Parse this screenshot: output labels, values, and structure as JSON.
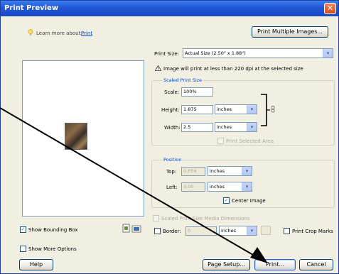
{
  "window": {
    "title": "Print Preview",
    "close_glyph": "✕"
  },
  "learn": {
    "prefix": "Learn more about:",
    "link": "Print"
  },
  "print_multiple_label": "Print Multiple Images...",
  "print_size": {
    "label": "Print Size:",
    "value": "Actual Size (2.50\" x 1.88\")"
  },
  "warning": "Image will print at less than 220 dpi at the selected size",
  "scaled": {
    "title": "Scaled Print Size",
    "scale_label": "Scale:",
    "scale_value": "100%",
    "height_label": "Height:",
    "height_value": "1.875",
    "height_unit": "inches",
    "width_label": "Width:",
    "width_value": "2.5",
    "width_unit": "inches",
    "print_selected_label": "Print Selected Area"
  },
  "position": {
    "title": "Position",
    "top_label": "Top:",
    "top_value": "0.656",
    "top_unit": "inches",
    "left_label": "Left:",
    "left_value": "3.00",
    "left_unit": "inches",
    "center_image_label": "Center Image"
  },
  "media_label": "Scaled Print Size Media Dimensions",
  "border": {
    "label": "Border:",
    "value": "0",
    "unit": "inches"
  },
  "print_crop_marks_label": "Print Crop Marks",
  "show_bounding_box_label": "Show Bounding Box",
  "show_more_options_label": "Show More Options",
  "buttons": {
    "help": "Help",
    "page_setup": "Page Setup...",
    "print": "Print...",
    "cancel": "Cancel"
  },
  "checks": {
    "bounding_box": "✓",
    "center_image": "✓"
  },
  "icons": {
    "orientation": "orientation-icons",
    "bulb": "lightbulb-icon",
    "warning": "warning-icon",
    "link": "chain-link-icon"
  }
}
